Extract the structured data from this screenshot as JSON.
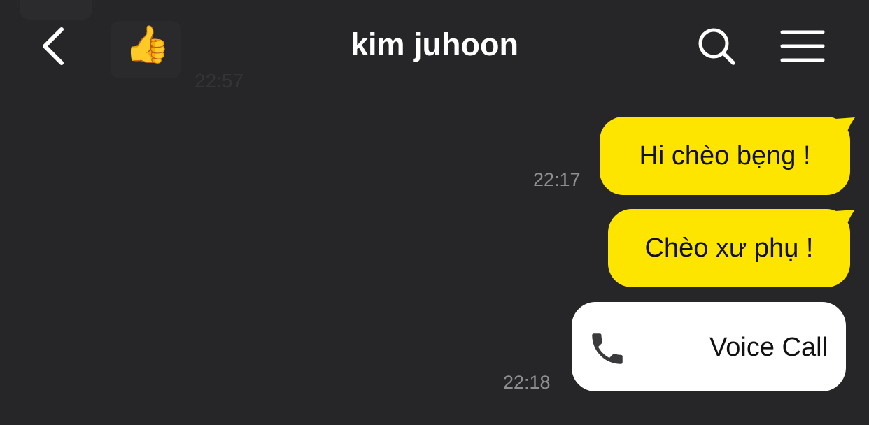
{
  "header": {
    "title": "kim juhoon"
  },
  "background_message": {
    "time": "22:57"
  },
  "messages": [
    {
      "text": "Hi chèo bẹng !",
      "time": "22:17"
    },
    {
      "text": "Chèo xư phụ !",
      "time": ""
    }
  ],
  "voice_call": {
    "label": "Voice Call",
    "time": "22:18"
  },
  "icons": {
    "back": "chevron-left-icon",
    "search": "search-icon",
    "menu": "hamburger-menu-icon",
    "phone": "phone-icon",
    "sticker": "thumbs-up-icon"
  },
  "colors": {
    "background": "#262628",
    "bubble": "#fee500",
    "timestamp": "#8e8e93",
    "card": "#ffffff"
  }
}
